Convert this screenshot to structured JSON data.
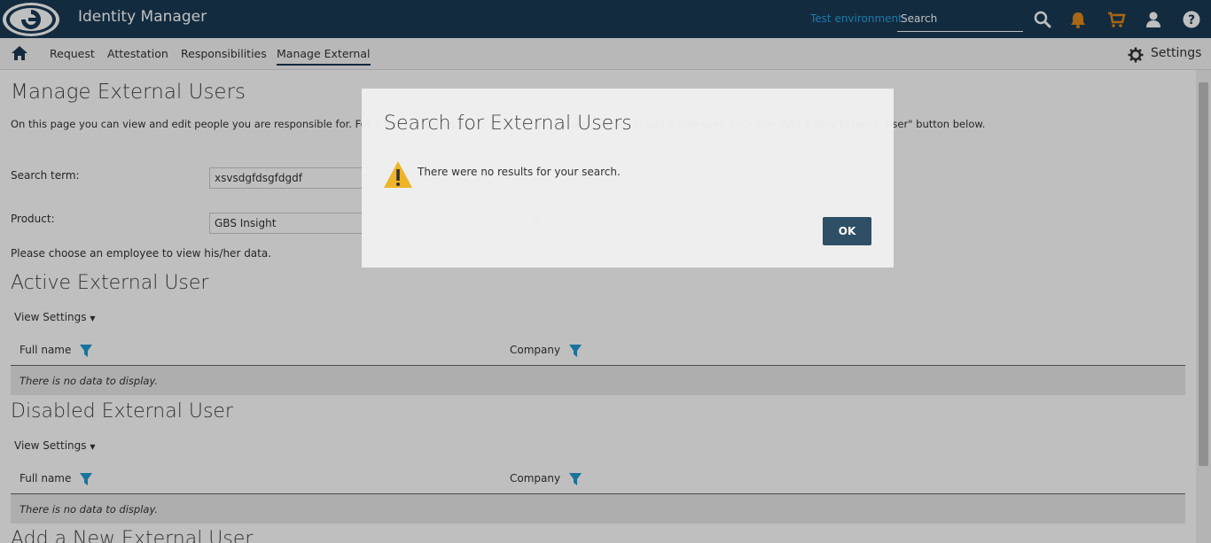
{
  "app": {
    "title": "Identity Manager",
    "environment": "Test environment"
  },
  "topbar": {
    "search_placeholder": "Search",
    "icons": [
      "search-icon",
      "bell-icon",
      "cart-icon",
      "user-icon",
      "help-icon"
    ],
    "colors": {
      "background": "#1a3a55",
      "bell": "#e08a1a",
      "cart": "#e08a1a",
      "env": "#2aa0e0"
    }
  },
  "nav": {
    "items": [
      {
        "label": "Request"
      },
      {
        "label": "Attestation"
      },
      {
        "label": "Responsibilities"
      },
      {
        "label": "Manage External",
        "active": true
      }
    ],
    "settings_label": "Settings"
  },
  "page": {
    "title": "Manage External Users",
    "description": "On this page you can view and edit people you are responsible for. For a more detailed view, click on the person's name. To add a new user, click the \"Add a New External User\" button below.",
    "search_term_label": "Search term:",
    "search_term_value": "xsvsdgfdsgfdgdf",
    "product_label": "Product:",
    "product_value": "GBS Insight",
    "choose_text": "Please choose an employee to view his/her data."
  },
  "active_section": {
    "title": "Active External User",
    "view_settings": "View Settings",
    "columns": [
      "Full name",
      "Company"
    ],
    "empty": "There is no data to display."
  },
  "disabled_section": {
    "title": "Disabled External User",
    "view_settings": "View Settings",
    "columns": [
      "Full name",
      "Company"
    ],
    "empty": "There is no data to display."
  },
  "add_section": {
    "title": "Add a New External User"
  },
  "dialog": {
    "title": "Search for External Users",
    "message": "There were no results for your search.",
    "ok_label": "OK",
    "colors": {
      "button": "#2f4f66",
      "warning": "#f0b429"
    }
  }
}
